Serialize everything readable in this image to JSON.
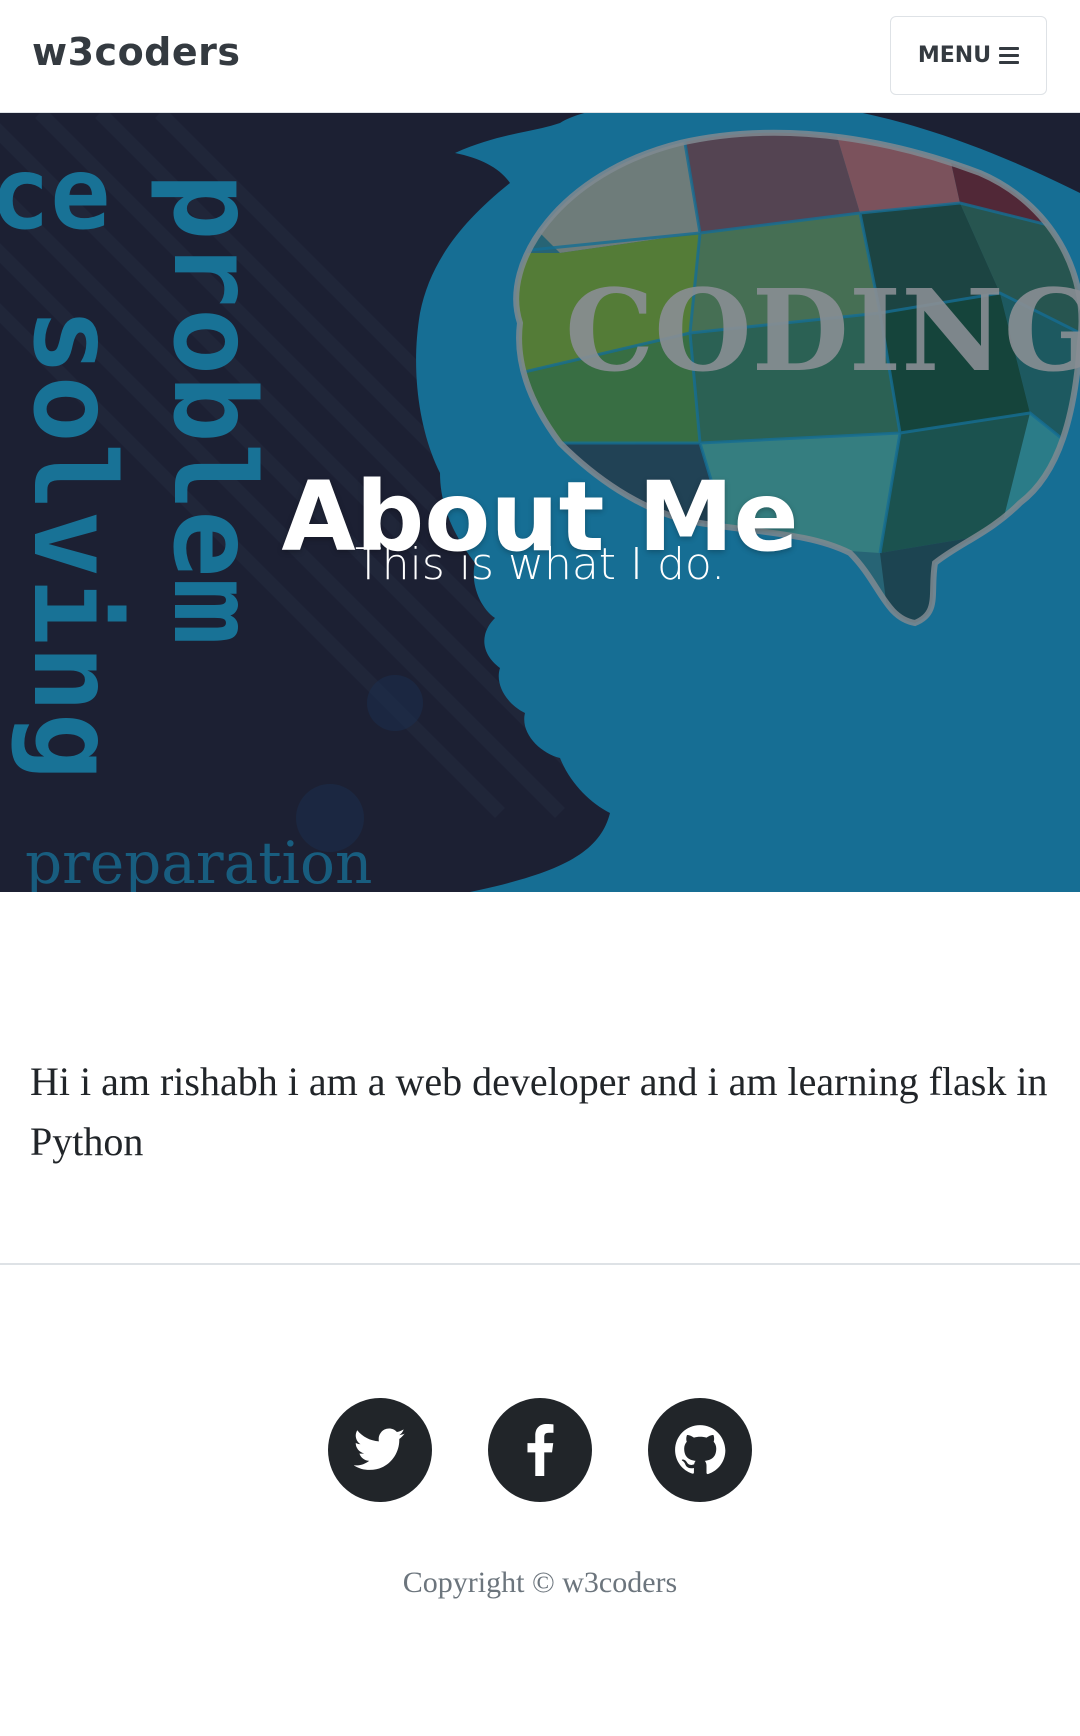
{
  "navbar": {
    "brand": "w3coders",
    "menu_label": "MENU"
  },
  "hero": {
    "title": "About Me",
    "subtitle": "This is what I do.",
    "background_words": {
      "coding": "CODING",
      "problem": "problem",
      "solving": "solving",
      "preparation": "preparation",
      "ce": "ce"
    }
  },
  "content": {
    "paragraph": "Hi i am rishabh i am a web developer and i am learning flask in Python"
  },
  "footer": {
    "social": [
      {
        "name": "twitter",
        "icon": "twitter-icon"
      },
      {
        "name": "facebook",
        "icon": "facebook-icon"
      },
      {
        "name": "github",
        "icon": "github-icon"
      }
    ],
    "copyright": "Copyright © w3coders"
  },
  "colors": {
    "hero_bg": "#1e2235",
    "hero_blue": "#177aa3",
    "text_dark": "#212529",
    "muted": "#6c757d"
  }
}
